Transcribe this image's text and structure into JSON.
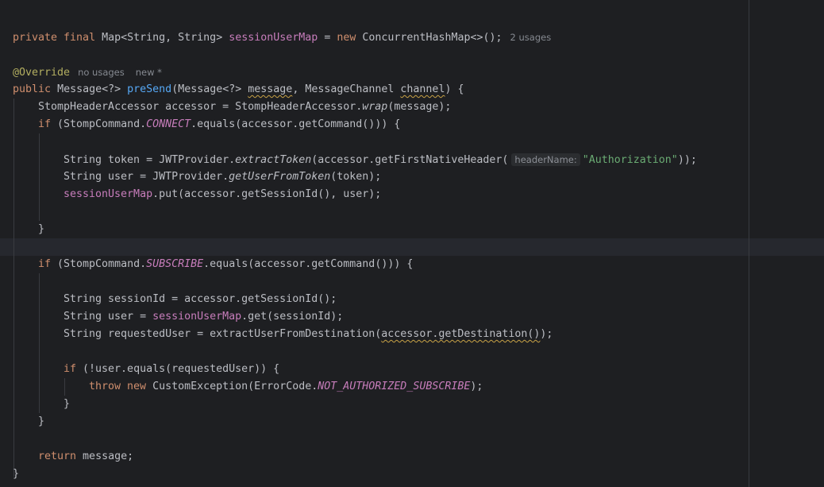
{
  "editor": {
    "field_decl": {
      "modifiers": "private final",
      "type": "Map<String, String>",
      "name": "sessionUserMap",
      "eq": "=",
      "new_kw": "new",
      "ctor": "ConcurrentHashMap<>();",
      "usages_hint": "2 usages"
    },
    "annotation": {
      "text": "@Override",
      "usages_hint": "no usages",
      "new_hint": "new *"
    },
    "method_sig": {
      "modifier": "public",
      "ret_type": "Message<?>",
      "name": "preSend",
      "open": "(Message<?> ",
      "param1": "message",
      "sep": ", MessageChannel ",
      "param2": "channel",
      "close": ") {"
    },
    "accessor_line": {
      "pre": "StompHeaderAccessor accessor = StompHeaderAccessor.",
      "call": "wrap",
      "post": "(message);"
    },
    "if_connect": {
      "kw": "if",
      "pre": " (StompCommand.",
      "const": "CONNECT",
      "post": ".equals(accessor.getCommand())) {"
    },
    "token_line": {
      "pre": "String token = JWTProvider.",
      "call": "extractToken",
      "mid": "(accessor.getFirstNativeHeader(",
      "param_hint": "headerName:",
      "str": "\"Authorization\"",
      "post": "));"
    },
    "user_line": {
      "pre": "String user = JWTProvider.",
      "call": "getUserFromToken",
      "post": "(token);"
    },
    "put_line": {
      "field": "sessionUserMap",
      "post": ".put(accessor.getSessionId(), user);"
    },
    "close_brace": "}",
    "if_subscribe": {
      "kw": "if",
      "pre": " (StompCommand.",
      "const": "SUBSCRIBE",
      "post": ".equals(accessor.getCommand())) {"
    },
    "session_id_line": "String sessionId = accessor.getSessionId();",
    "sub_user_line": {
      "pre": "String user = ",
      "field": "sessionUserMap",
      "post": ".get(sessionId);"
    },
    "requested_line": {
      "pre": "String requestedUser = extractUserFromDestination(",
      "warn": "accessor.getDestination()",
      "post": ");"
    },
    "if_equals": {
      "kw": "if",
      "post": " (!user.equals(requestedUser)) {"
    },
    "throw_line": {
      "throw_kw": "throw",
      "new_kw": "new",
      "pre": " CustomException(ErrorCode.",
      "const": "NOT_AUTHORIZED_SUBSCRIBE",
      "post": ");"
    },
    "return_line": {
      "kw": "return",
      "post": " message;"
    }
  }
}
